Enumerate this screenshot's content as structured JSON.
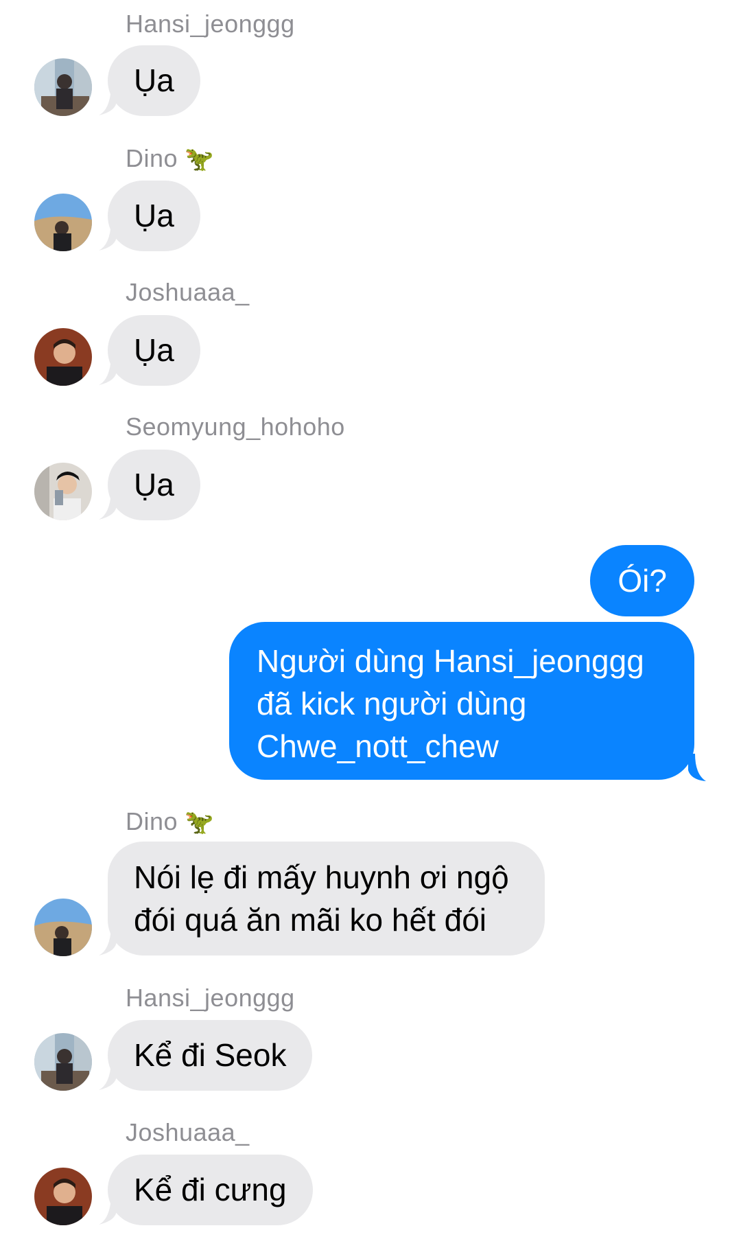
{
  "messages": [
    {
      "sender": "Hansi_jeonggg",
      "text": "Ụa"
    },
    {
      "sender": "Dino",
      "sender_emoji": "🦖",
      "text": "Ụa"
    },
    {
      "sender": "Joshuaaa_",
      "text": "Ụa"
    },
    {
      "sender": "Seomyung_hohoho",
      "text": "Ụa"
    },
    {
      "outgoing": true,
      "text": "Ói?"
    },
    {
      "outgoing": true,
      "lines": [
        "Người dùng Hansi_jeonggg",
        "đã kick người dùng",
        "Chwe_nott_chew"
      ]
    },
    {
      "sender": "Dino",
      "sender_emoji": "🦖",
      "lines": [
        "Nói lẹ đi mấy huynh ơi ngộ",
        "đói quá ăn mãi ko hết đói"
      ]
    },
    {
      "sender": "Hansi_jeonggg",
      "text": "Kể đi Seok"
    },
    {
      "sender": "Joshuaaa_",
      "text": "Kể đi cưng"
    }
  ],
  "colors": {
    "incoming_bubble": "#e9e9eb",
    "outgoing_bubble": "#0a84ff",
    "sender_name": "#8e8e93"
  }
}
